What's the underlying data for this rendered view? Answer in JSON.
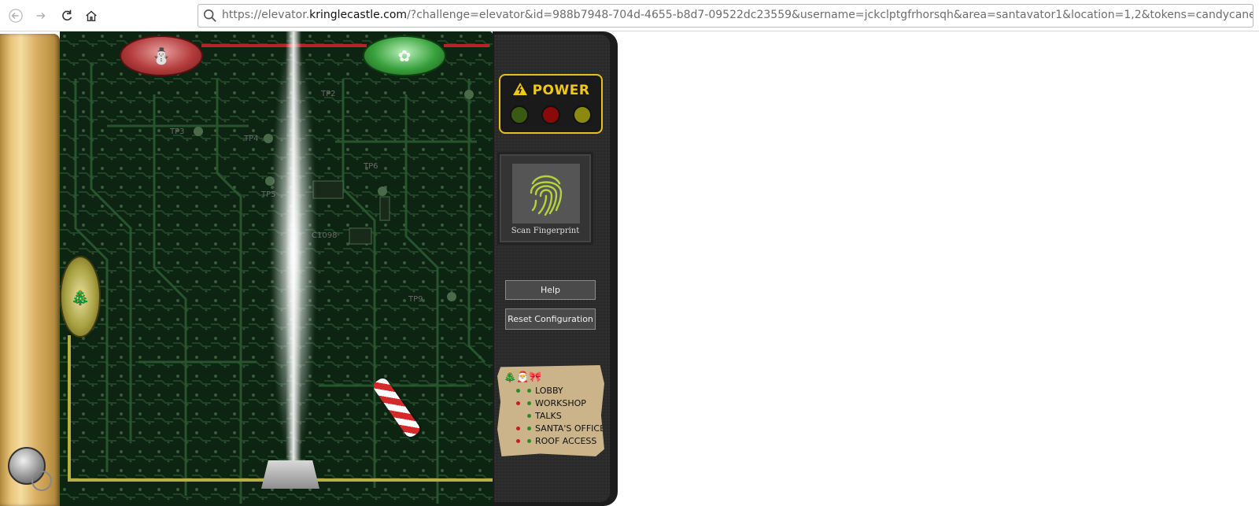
{
  "browser": {
    "url_prefix": "https://elevator.",
    "url_domain": "kringlecastle.com",
    "url_rest": "/?challenge=elevator&id=988b7948-704d-4655-b8d7-09522dc23559&username=jckclptgfrhorsqh&area=santavator1&location=1,2&tokens=candycane,el",
    "icons": [
      "back-arrow-icon",
      "forward-arrow-icon",
      "reload-icon",
      "home-icon",
      "search-icon"
    ]
  },
  "sockets": {
    "red_icon": "santa-hat-icon",
    "green_icon": "bow-icon",
    "gold_icon": "tree-icon"
  },
  "power": {
    "title": "POWER",
    "warning_icon": "warning-icon",
    "leds": [
      {
        "name": "green",
        "color": "#3a5a12"
      },
      {
        "name": "red",
        "color": "#8a0a0a"
      },
      {
        "name": "yellow",
        "color": "#8a8a10"
      }
    ]
  },
  "scanner": {
    "label": "Scan Fingerprint",
    "icon": "fingerprint-icon"
  },
  "buttons": {
    "help": "Help",
    "reset": "Reset Configuration"
  },
  "floors": {
    "header_icons": "🎄🎅🎀",
    "items": [
      {
        "label": "LOBBY",
        "dot_left": "#2a8a2a",
        "dot_right": "#2a8a2a"
      },
      {
        "label": "WORKSHOP",
        "dot_left": "#c02020",
        "dot_right": "#2a8a2a"
      },
      {
        "label": "TALKS",
        "dot_left": "",
        "dot_right": "#2a8a2a"
      },
      {
        "label": "SANTA'S OFFICE",
        "dot_left": "#c02020",
        "dot_right": "#2a8a2a"
      },
      {
        "label": "ROOF ACCESS",
        "dot_left": "#c02020",
        "dot_right": "#2a8a2a"
      }
    ]
  }
}
